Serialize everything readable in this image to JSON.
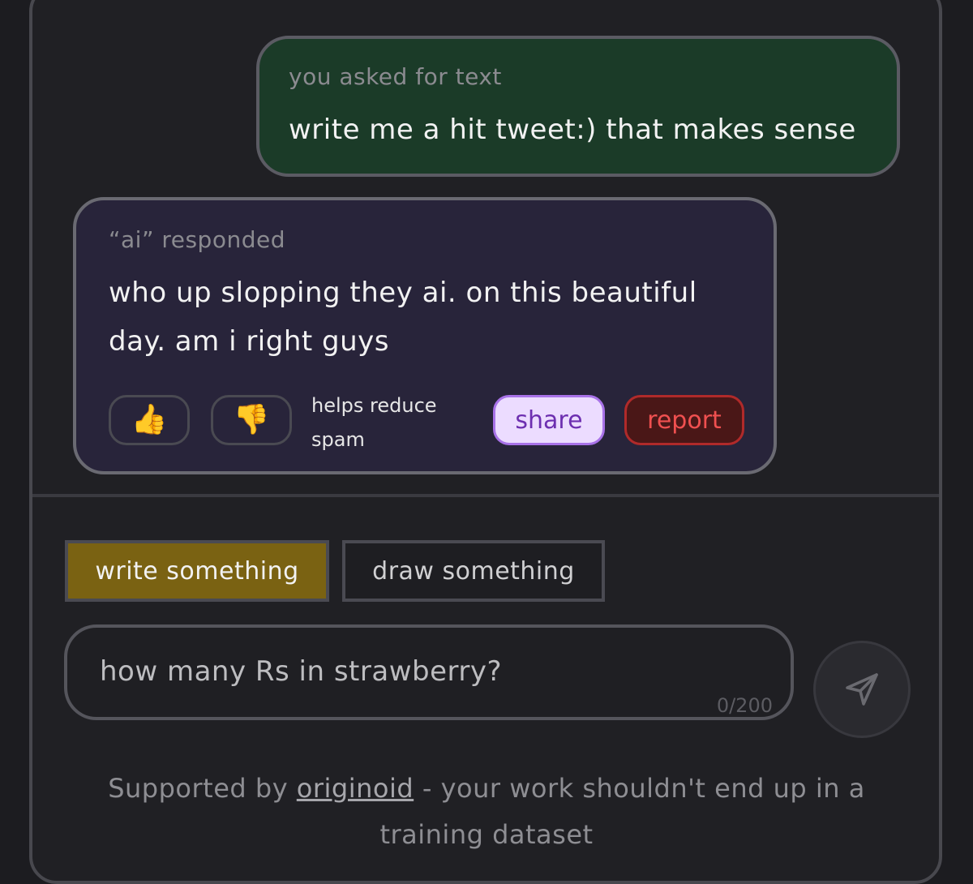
{
  "conversation": {
    "user_message": {
      "caption": "you asked for text",
      "text": "write me a hit tweet:) that makes sense"
    },
    "ai_message": {
      "caption": "“ai” responded",
      "text": "who up slopping they ai. on this beautiful day. am i right guys",
      "actions": {
        "thumbs_up": "👍",
        "thumbs_down": "👎",
        "vote_hint": "helps reduce spam",
        "share_label": "share",
        "report_label": "report"
      }
    }
  },
  "composer": {
    "modes": {
      "write_label": "write something",
      "draw_label": "draw something",
      "selected": "write something"
    },
    "input": {
      "value": "how many Rs in strawberry?",
      "char_count": "0/200"
    },
    "send_icon": "send-icon"
  },
  "footer": {
    "prefix": "Supported by ",
    "link_text": "originoid",
    "suffix": " - your work shouldn't end up in a training dataset"
  },
  "colors": {
    "user_bubble": "#1b3b28",
    "ai_bubble": "#28243a",
    "write_mode_active": "#7a6212",
    "share_bg": "#ecdcff",
    "report_bg": "#4a1717"
  }
}
